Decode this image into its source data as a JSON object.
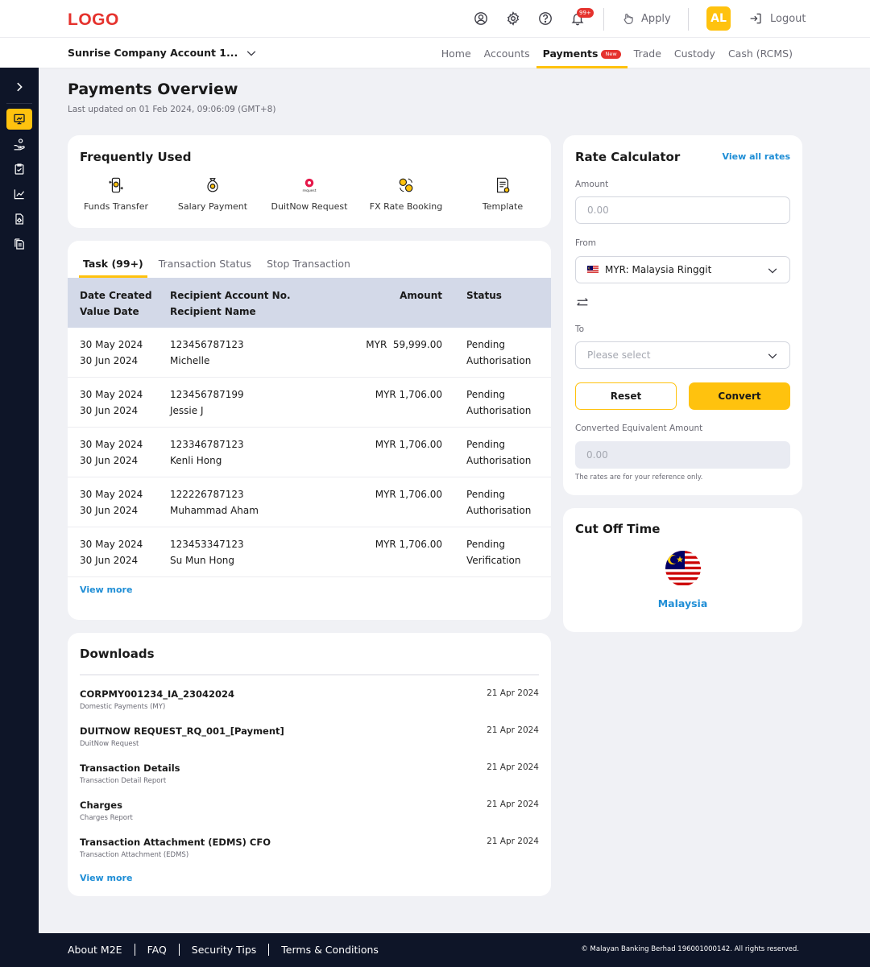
{
  "header": {
    "logo": "LOGO",
    "notification_count": "99+",
    "apply_label": "Apply",
    "avatar_initials": "AL",
    "logout_label": "Logout"
  },
  "subnav": {
    "account": "Sunrise Company Account 1...",
    "tabs": [
      {
        "label": "Home"
      },
      {
        "label": "Accounts"
      },
      {
        "label": "Payments",
        "badge": "New"
      },
      {
        "label": "Trade"
      },
      {
        "label": "Custody"
      },
      {
        "label": "Cash (RCMS)"
      }
    ]
  },
  "page": {
    "title": "Payments Overview",
    "last_updated": "Last updated on 01 Feb 2024, 09:06:09 (GMT+8)"
  },
  "frequently_used": {
    "title": "Frequently Used",
    "items": [
      {
        "label": "Funds Transfer",
        "icon": "funds-transfer-icon"
      },
      {
        "label": "Salary Payment",
        "icon": "salary-payment-icon"
      },
      {
        "label": "DuitNow Request",
        "icon": "duitnow-request-icon",
        "icon_text": "request"
      },
      {
        "label": "FX Rate Booking",
        "icon": "fx-rate-booking-icon"
      },
      {
        "label": "Template",
        "icon": "template-icon"
      }
    ]
  },
  "tasks": {
    "tabs": [
      "Task (99+)",
      "Transaction Status",
      "Stop Transaction"
    ],
    "headers": {
      "date_created": "Date Created",
      "value_date": "Value Date",
      "account_no": "Recipient Account No.",
      "recipient_name": "Recipient Name",
      "amount": "Amount",
      "status": "Status"
    },
    "rows": [
      {
        "date_created": "30 May 2024",
        "value_date": "30 Jun 2024",
        "account_no": "123456787123",
        "name": "Michelle",
        "amount": "MYR  59,999.00",
        "status_1": "Pending",
        "status_2": "Authorisation"
      },
      {
        "date_created": "30 May 2024",
        "value_date": "30 Jun 2024",
        "account_no": "123456787199",
        "name": "Jessie J",
        "amount": "MYR 1,706.00",
        "status_1": "Pending",
        "status_2": "Authorisation"
      },
      {
        "date_created": "30 May 2024",
        "value_date": "30 Jun 2024",
        "account_no": "123346787123",
        "name": "Kenli Hong",
        "amount": "MYR 1,706.00",
        "status_1": "Pending",
        "status_2": "Authorisation"
      },
      {
        "date_created": "30 May 2024",
        "value_date": "30 Jun 2024",
        "account_no": "122226787123",
        "name": "Muhammad Aham",
        "amount": "MYR 1,706.00",
        "status_1": "Pending",
        "status_2": "Authorisation"
      },
      {
        "date_created": "30 May 2024",
        "value_date": "30 Jun 2024",
        "account_no": "123453347123",
        "name": "Su Mun Hong",
        "amount": "MYR 1,706.00",
        "status_1": "Pending",
        "status_2": "Verification"
      }
    ],
    "view_more": "View more"
  },
  "downloads": {
    "title": "Downloads",
    "items": [
      {
        "name": "CORPMY001234_IA_23042024",
        "type": "Domestic Payments (MY)",
        "date": "21 Apr 2024"
      },
      {
        "name": "DUITNOW REQUEST_RQ_001_[Payment]",
        "type": "DuitNow Request",
        "date": "21 Apr 2024"
      },
      {
        "name": "Transaction Details",
        "type": "Transaction Detail Report",
        "date": "21 Apr 2024"
      },
      {
        "name": "Charges",
        "type": "Charges Report",
        "date": "21 Apr 2024"
      },
      {
        "name": "Transaction Attachment (EDMS) CFO",
        "type": "Transaction Attachment (EDMS)",
        "date": "21 Apr 2024"
      }
    ],
    "view_more": "View more"
  },
  "rate_calculator": {
    "title": "Rate Calculator",
    "view_all": "View all rates",
    "amount_label": "Amount",
    "amount_placeholder": "0.00",
    "from_label": "From",
    "from_value": "MYR: Malaysia Ringgit",
    "to_label": "To",
    "to_placeholder": "Please select",
    "reset_label": "Reset",
    "convert_label": "Convert",
    "converted_label": "Converted Equivalent Amount",
    "converted_value": "0.00",
    "note": "The rates are for your reference only."
  },
  "cut_off": {
    "title": "Cut Off Time",
    "country": "Malaysia"
  },
  "footer": {
    "links": [
      "About M2E",
      "FAQ",
      "Security Tips",
      "Terms & Conditions"
    ],
    "copyright": "© Malayan Banking Berhad 196001000142. All rights reserved."
  },
  "colors": {
    "accent": "#ffc20e",
    "brand_red": "#e5322d",
    "link_blue": "#1f8ed6",
    "navy": "#0e1528",
    "table_header": "#d3d9e8"
  }
}
